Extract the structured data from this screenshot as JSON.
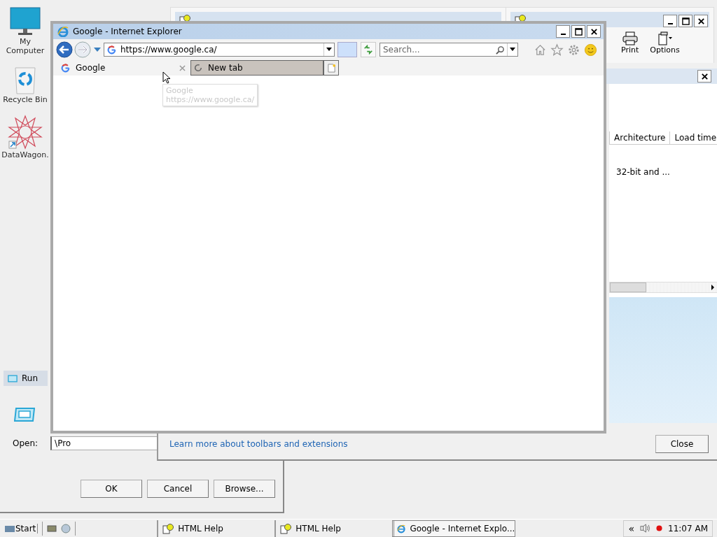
{
  "desktop_icons": [
    {
      "label": "My Computer",
      "kind": "computer"
    },
    {
      "label": "Recycle Bin",
      "kind": "recycle"
    },
    {
      "label": "DataWagon.",
      "kind": "app"
    }
  ],
  "help_toolbar": {
    "buttons": [
      {
        "label": "Print",
        "kind": "print"
      },
      {
        "label": "Options",
        "kind": "options"
      }
    ]
  },
  "addons_dialog": {
    "columns": [
      "Architecture",
      "Load time"
    ],
    "cell": "32-bit and ...",
    "link": "Learn more about toolbars and extensions",
    "close_button": "Close"
  },
  "browser": {
    "title": "Google - Internet Explorer",
    "address": "https://www.google.ca/",
    "search": {
      "placeholder": "Search..."
    },
    "tabs": [
      {
        "label": "Google",
        "selected": true,
        "loading": false
      },
      {
        "label": "New tab",
        "selected": false,
        "loading": true
      }
    ],
    "tooltip": {
      "title": "Google",
      "url": "https://www.google.ca/"
    }
  },
  "run_dialog": {
    "title": "Run",
    "open_label": "Open:",
    "value": "\\Pro",
    "buttons": [
      "OK",
      "Cancel",
      "Browse..."
    ]
  },
  "taskbar": {
    "start": "Start",
    "chevron": "«",
    "tasks": [
      {
        "label": "HTML Help",
        "kind": "help",
        "selected": false
      },
      {
        "label": "HTML Help",
        "kind": "help",
        "selected": false
      },
      {
        "label": "Google - Internet Explo...",
        "kind": "browser",
        "selected": true
      }
    ],
    "clock": "11:07 AM"
  }
}
